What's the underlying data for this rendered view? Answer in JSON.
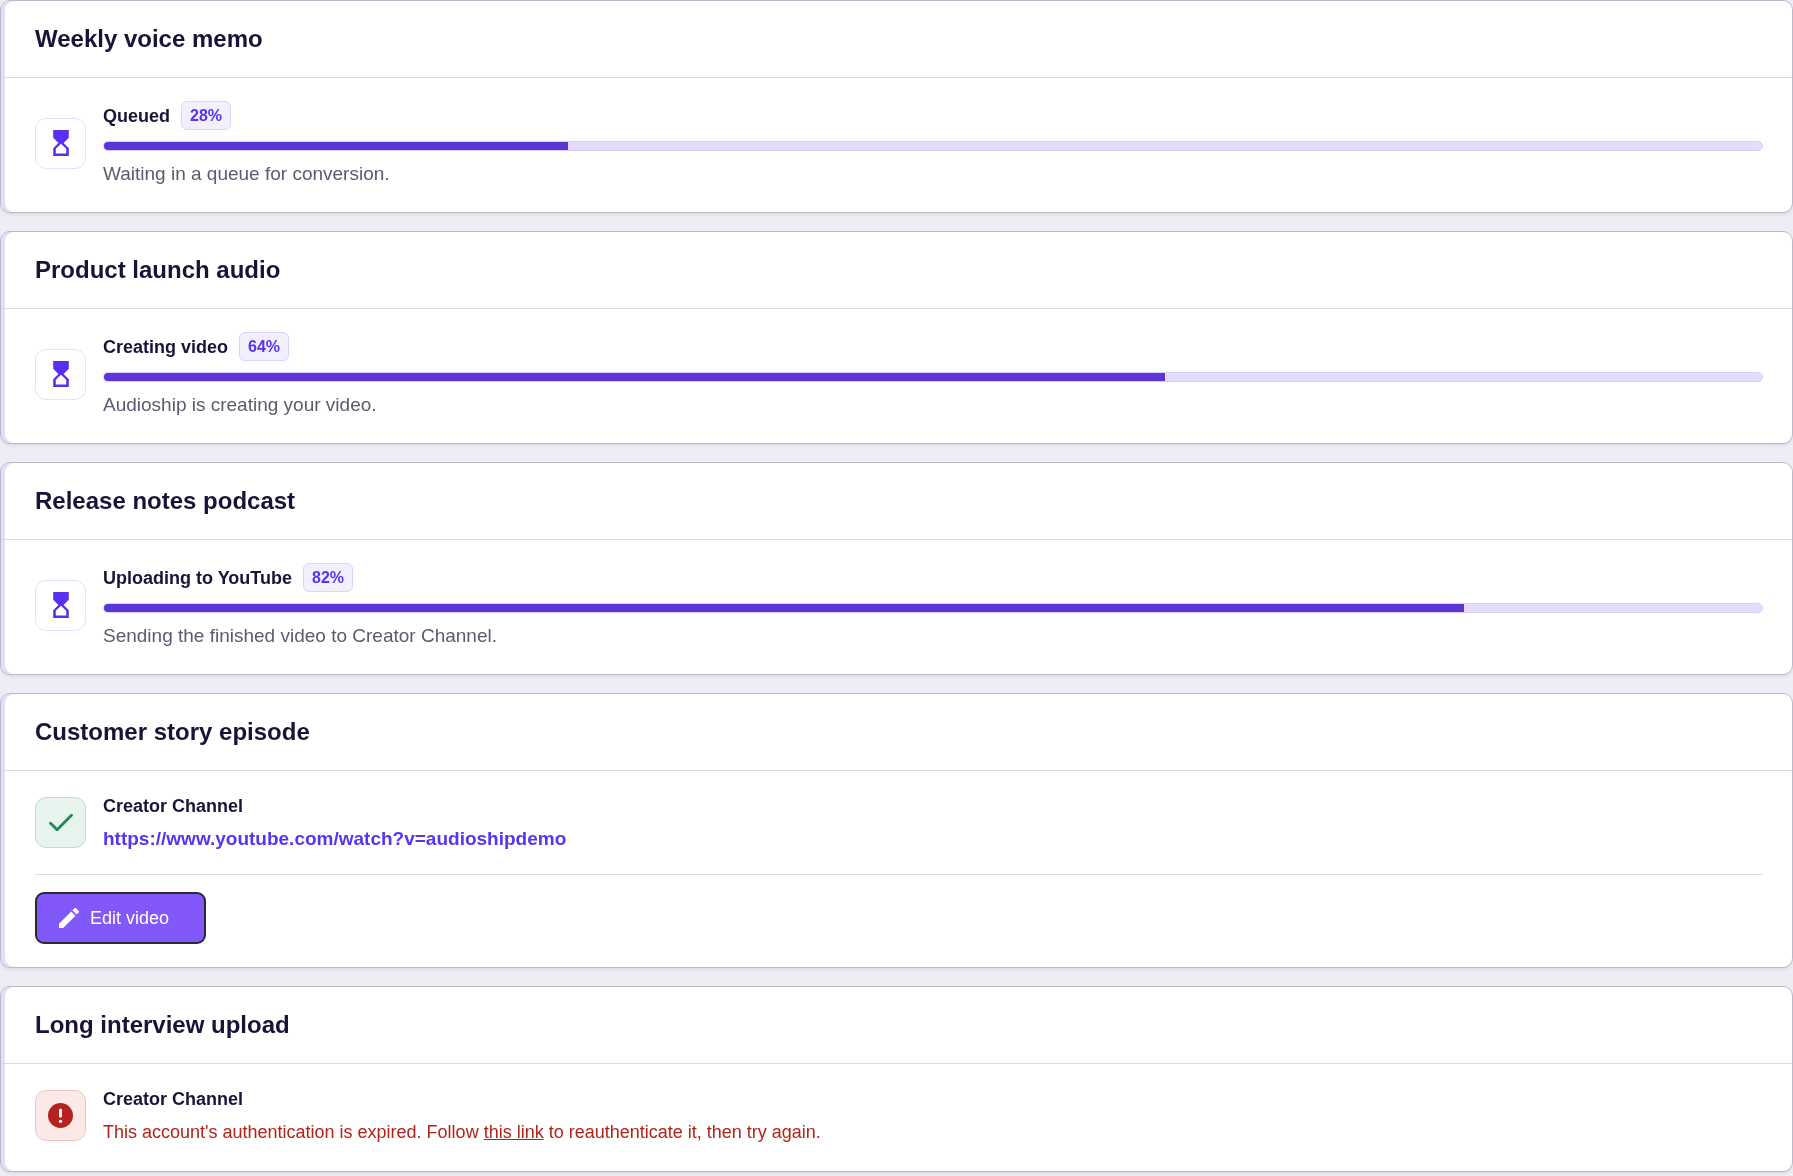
{
  "jobs": [
    {
      "title": "Weekly voice memo",
      "status": {
        "kind": "progress",
        "label": "Queued",
        "badge": "28%",
        "level": 0.28,
        "description": "Waiting in a queue for conversion."
      }
    },
    {
      "title": "Product launch audio",
      "status": {
        "kind": "progress",
        "label": "Creating video",
        "badge": "64%",
        "level": 0.64,
        "description": "Audioship is creating your video."
      }
    },
    {
      "title": "Release notes podcast",
      "status": {
        "kind": "progress",
        "label": "Uploading to YouTube",
        "badge": "82%",
        "level": 0.82,
        "description": "Sending the finished video to Creator Channel."
      }
    },
    {
      "title": "Customer story episode",
      "status": {
        "kind": "success",
        "label": "Creator Channel",
        "link": "https://www.youtube.com/watch?v=audioshipdemo"
      },
      "button": {
        "label": "Edit video"
      }
    },
    {
      "title": "Long interview upload",
      "status": {
        "kind": "error",
        "label": "Creator Channel",
        "message_start": "This account's authentication is expired. Follow",
        "link_text": "this link",
        "message_end": "to reauthenticate it, then try again."
      }
    }
  ]
}
